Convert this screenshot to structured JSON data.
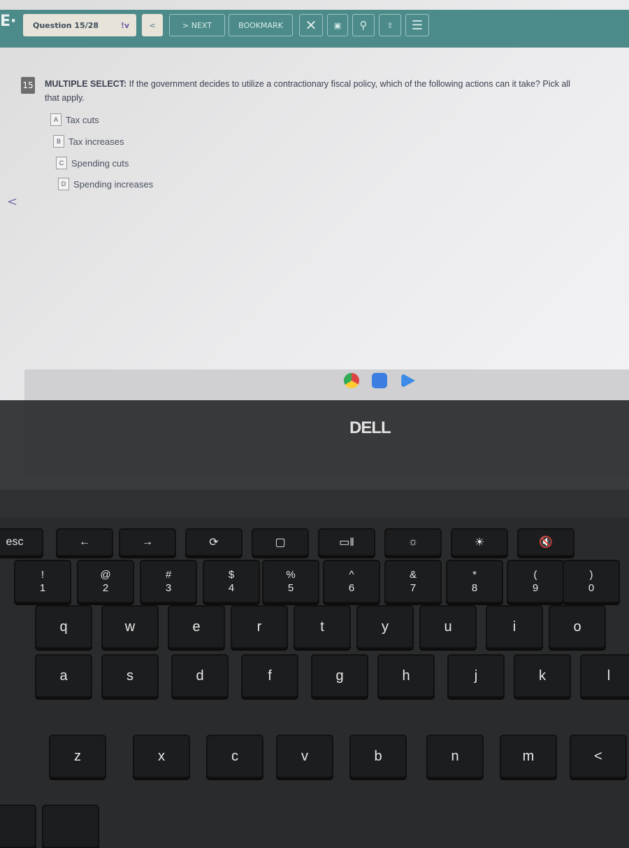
{
  "toolbar": {
    "logo": "E·",
    "question_selector": "Question 15/28",
    "flag_icon": "!v",
    "prev": "<",
    "next": "> NEXT",
    "bookmark": "BOOKMARK",
    "icons": [
      "close-icon",
      "calculator-icon",
      "search-icon",
      "upload-icon",
      "menu-icon"
    ]
  },
  "question": {
    "number": "15",
    "label": "MULTIPLE SELECT:",
    "text": " If the government decides to utilize a contractionary fiscal policy, which of the following actions can it take? Pick all that apply.",
    "options": [
      {
        "letter": "A",
        "text": "Tax cuts"
      },
      {
        "letter": "B",
        "text": "Tax increases"
      },
      {
        "letter": "C",
        "text": "Spending cuts"
      },
      {
        "letter": "D",
        "text": "Spending increases"
      }
    ]
  },
  "shelf": {
    "apps": [
      "chrome",
      "files",
      "play-store"
    ]
  },
  "brand": "DELL",
  "keyboard": {
    "fn_row": [
      "esc",
      "←",
      "→",
      "⟳",
      "▢",
      "▭‖",
      "☼",
      "☀",
      "🔇"
    ],
    "number_row": [
      [
        "!",
        "1"
      ],
      [
        "@",
        "2"
      ],
      [
        "#",
        "3"
      ],
      [
        "$",
        "4"
      ],
      [
        "%",
        "5"
      ],
      [
        "^",
        "6"
      ],
      [
        "&",
        "7"
      ],
      [
        "*",
        "8"
      ],
      [
        "(",
        "9"
      ],
      [
        ")",
        "0"
      ]
    ],
    "q_row": [
      "q",
      "w",
      "e",
      "r",
      "t",
      "y",
      "u",
      "i",
      "o"
    ],
    "a_row": [
      "a",
      "s",
      "d",
      "f",
      "g",
      "h",
      "j",
      "k",
      "l"
    ],
    "z_row": [
      "z",
      "x",
      "c",
      "v",
      "b",
      "n",
      "m",
      "<"
    ]
  }
}
